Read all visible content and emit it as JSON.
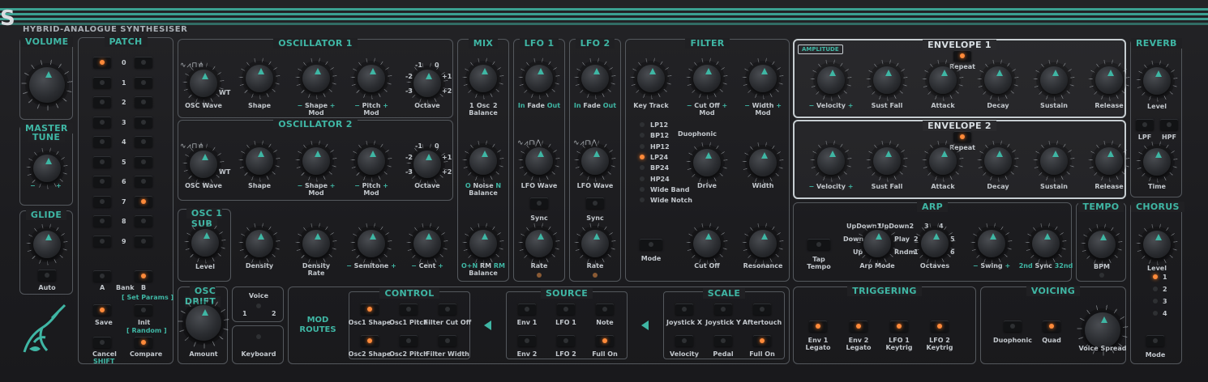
{
  "brand": {
    "logo": "S",
    "subtitle": "HYBRID-ANALOGUE SYNTHESISER"
  },
  "colors": {
    "accent": "#3fb6a4",
    "led_on": "#ff8a3a",
    "panel_border": "#54585d",
    "highlight_border": "#c6cdd1"
  },
  "volume": {
    "title": "VOLUME"
  },
  "master_tune": {
    "title_line1": "MASTER",
    "title_line2": "TUNE",
    "minus": "−",
    "plus": "+"
  },
  "glide": {
    "title": "GLIDE",
    "auto": "Auto"
  },
  "patch": {
    "title": "PATCH",
    "numbers": [
      "0",
      "1",
      "2",
      "3",
      "4",
      "5",
      "6",
      "7",
      "8",
      "9"
    ],
    "a": "A",
    "bank": "Bank",
    "b": "B",
    "set_params": "[ Set Params ]",
    "save": "Save",
    "init": "Init",
    "random": "[ Random ]",
    "cancel": "Cancel",
    "shift": "SHIFT",
    "compare": "Compare"
  },
  "osc1": {
    "title": "OSCILLATOR 1",
    "wave": "OSC Wave",
    "wt": "WT",
    "shape": "Shape",
    "shape_mod": "Shape",
    "shape_mod2": "Mod",
    "pitch_mod": "Pitch",
    "pitch_mod2": "Mod",
    "octave": "Octave",
    "oct_labels": [
      "-1",
      "0",
      "-2",
      "+1",
      "-3",
      "+2"
    ]
  },
  "osc2": {
    "title": "OSCILLATOR 2",
    "wave": "OSC Wave",
    "wt": "WT",
    "shape": "Shape",
    "shape_mod": "Shape",
    "shape_mod2": "Mod",
    "pitch_mod": "Pitch",
    "pitch_mod2": "Mod",
    "octave": "Octave",
    "oct_labels": [
      "-1",
      "0",
      "-2",
      "+1",
      "-3",
      "+2"
    ]
  },
  "osc1_sub": {
    "title": "OSC 1 SUB",
    "level": "Level",
    "density": "Density",
    "density_rate": "Density",
    "density_rate2": "Rate",
    "semitone": "Semitone",
    "cent": "Cent"
  },
  "mix": {
    "title": "MIX",
    "osc_balance": "Osc",
    "osc_balance2": "Balance",
    "noise_balance": "Noise",
    "noise_balance2": "Balance",
    "rm_balance": "RM",
    "rm_balance2": "Balance",
    "one": "1",
    "two": "2",
    "o": "O",
    "n": "N",
    "o_n": "O+N",
    "rm": "RM"
  },
  "lfo1": {
    "title": "LFO 1",
    "in": "In",
    "fade": "Fade",
    "out": "Out",
    "wave": "LFO Wave",
    "sync": "Sync",
    "rate": "Rate"
  },
  "lfo2": {
    "title": "LFO 2",
    "in": "In",
    "fade": "Fade",
    "out": "Out",
    "wave": "LFO Wave",
    "sync": "Sync",
    "rate": "Rate"
  },
  "filter": {
    "title": "FILTER",
    "key_track": "Key Track",
    "cut_off_mod": "Cut Off",
    "cut_off_mod2": "Mod",
    "width_mod": "Width",
    "width_mod2": "Mod",
    "types": [
      "LP12",
      "BP12",
      "HP12",
      "LP24",
      "BP24",
      "HP24",
      "Wide Band",
      "Wide Notch"
    ],
    "duophonic": "Duophonic",
    "drive": "Drive",
    "width": "Width",
    "mode": "Mode",
    "cut_off": "Cut Off",
    "resonance": "Resonance"
  },
  "amplitude_badge": "AMPLITUDE",
  "env1": {
    "title": "ENVELOPE 1",
    "repeat": "Repeat",
    "velocity": "Velocity",
    "sust_fall": "Sust Fall",
    "attack": "Attack",
    "decay": "Decay",
    "sustain": "Sustain",
    "release": "Release"
  },
  "env2": {
    "title": "ENVELOPE 2",
    "repeat": "Repeat",
    "velocity": "Velocity",
    "sust_fall": "Sust Fall",
    "attack": "Attack",
    "decay": "Decay",
    "sustain": "Sustain",
    "release": "Release"
  },
  "reverb": {
    "title": "REVERB",
    "level": "Level",
    "lpf": "LPF",
    "hpf": "HPF",
    "time": "Time"
  },
  "arp": {
    "title": "ARP",
    "tap_tempo": "Tap",
    "tap_tempo2": "Tempo",
    "modes": [
      "UpDown1",
      "UpDown2",
      "Play",
      "Down",
      "Rndm",
      "Up"
    ],
    "arp_mode": "Arp Mode",
    "octaves": "Octaves",
    "oct_nums": [
      "3",
      "4",
      "2",
      "5",
      "1",
      "6"
    ],
    "swing": "Swing",
    "sync_2nd": "2nd",
    "sync": "Sync",
    "sync_32nd": "32nd"
  },
  "tempo": {
    "title": "TEMPO",
    "bpm": "BPM"
  },
  "chorus": {
    "title": "CHORUS",
    "level": "Level",
    "options": [
      "1",
      "2",
      "3",
      "4"
    ],
    "mode": "Mode"
  },
  "osc_drift": {
    "title": "OSC DRIFT",
    "amount": "Amount"
  },
  "voice": {
    "title": "Voice",
    "one": "1",
    "two": "2",
    "keyboard": "Keyboard"
  },
  "mod_routes": {
    "title_line1": "MOD",
    "title_line2": "ROUTES",
    "control": "CONTROL",
    "source": "SOURCE",
    "scale": "SCALE",
    "control_top": [
      "Osc1 Shape",
      "Osc1 Pitch",
      "Filter Cut Off"
    ],
    "control_bottom": [
      "Osc2 Shape",
      "Osc2 Pitch",
      "Filter Width"
    ],
    "source_top": [
      "Env 1",
      "LFO 1",
      "Note"
    ],
    "source_bottom": [
      "Env 2",
      "LFO 2",
      "Full On"
    ],
    "scale_top": [
      "Joystick X",
      "Joystick Y",
      "Aftertouch"
    ],
    "scale_bottom": [
      "Velocity",
      "Pedal",
      "Full On"
    ]
  },
  "triggering": {
    "title": "TRIGGERING",
    "items": [
      [
        "Env 1",
        "Legato"
      ],
      [
        "Env 2",
        "Legato"
      ],
      [
        "LFO 1",
        "Keytrig"
      ],
      [
        "LFO 2",
        "Keytrig"
      ]
    ]
  },
  "voicing": {
    "title": "VOICING",
    "duophonic": "Duophonic",
    "quad": "Quad",
    "voice_spread": "Voice Spread"
  }
}
